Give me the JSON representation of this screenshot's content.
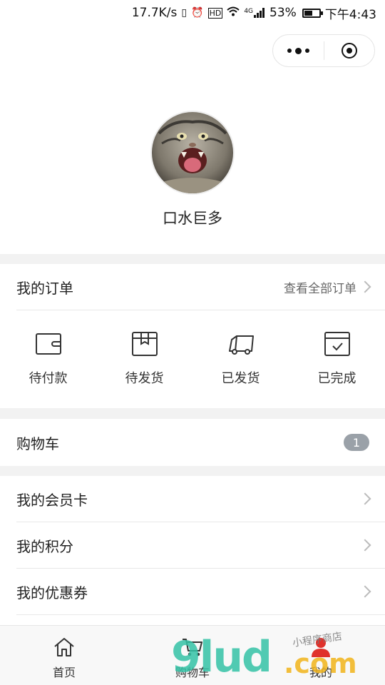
{
  "status_bar": {
    "speed": "17.7K/s",
    "network": "4G",
    "battery_percent": "53%",
    "battery_level": 0.53,
    "time": "下午4:43",
    "icons": [
      "vibrate-icon",
      "alarm-icon",
      "hd-icon",
      "wifi-icon",
      "signal-icon",
      "battery-icon"
    ]
  },
  "profile": {
    "username": "口水巨多"
  },
  "orders": {
    "title": "我的订单",
    "view_all": "查看全部订单",
    "statuses": [
      {
        "label": "待付款",
        "icon": "wallet-icon"
      },
      {
        "label": "待发货",
        "icon": "package-icon"
      },
      {
        "label": "已发货",
        "icon": "truck-icon"
      },
      {
        "label": "已完成",
        "icon": "completed-box-icon"
      }
    ]
  },
  "cart_row": {
    "label": "购物车",
    "count": "1"
  },
  "menu": {
    "items": [
      {
        "label": "我的会员卡"
      },
      {
        "label": "我的积分"
      },
      {
        "label": "我的优惠券"
      }
    ]
  },
  "tabbar": {
    "tabs": [
      {
        "label": "首页",
        "icon": "home-icon"
      },
      {
        "label": "购物车",
        "icon": "cart-icon"
      },
      {
        "label": "我的",
        "icon": "user-icon",
        "active": true
      }
    ]
  },
  "watermark": {
    "main": "9lud",
    "suffix": ".com",
    "small": "小程序商店"
  },
  "colors": {
    "separator": "#f2f2f2",
    "badge": "#9aa1a8",
    "active_tab": "#e0312b",
    "watermark_green": "#34c3a6",
    "watermark_yellow": "#f2b41b"
  }
}
